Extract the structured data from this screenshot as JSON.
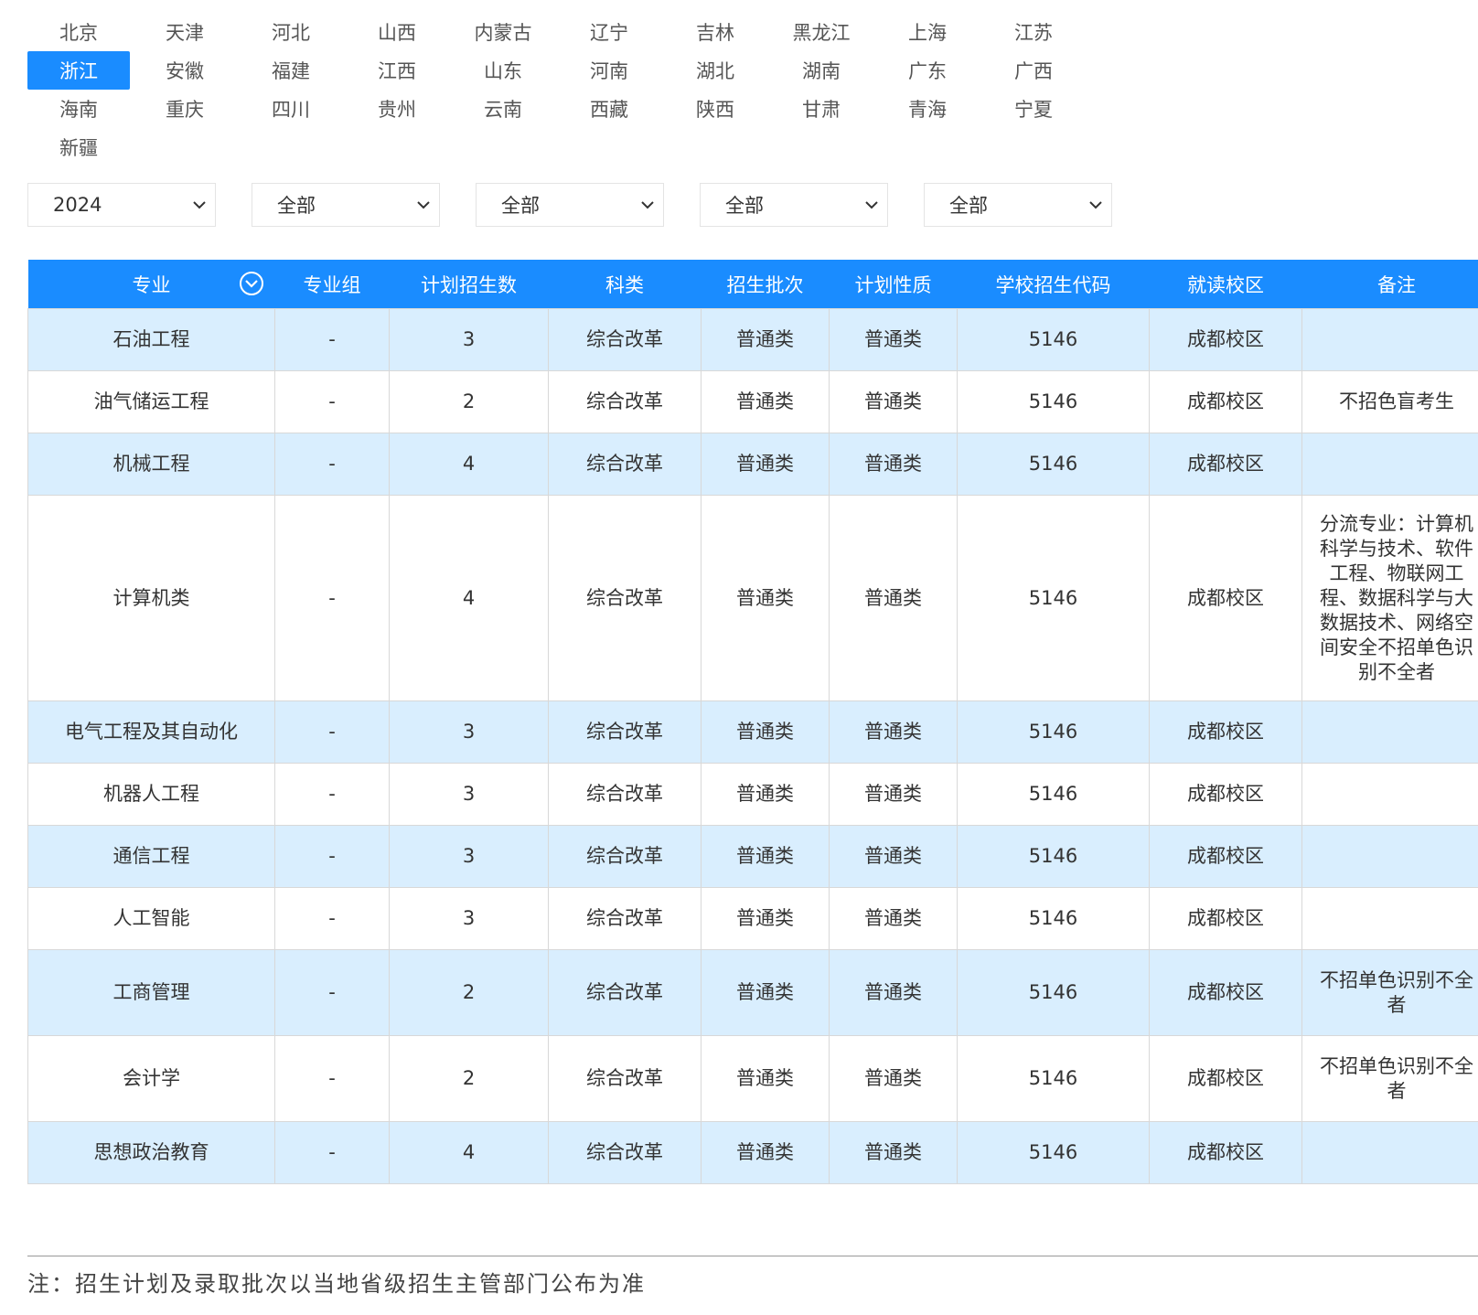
{
  "provinces": {
    "items": [
      "北京",
      "天津",
      "河北",
      "山西",
      "内蒙古",
      "辽宁",
      "吉林",
      "黑龙江",
      "上海",
      "江苏",
      "浙江",
      "安徽",
      "福建",
      "江西",
      "山东",
      "河南",
      "湖北",
      "湖南",
      "广东",
      "广西",
      "海南",
      "重庆",
      "四川",
      "贵州",
      "云南",
      "西藏",
      "陕西",
      "甘肃",
      "青海",
      "宁夏",
      "新疆"
    ],
    "selected": "浙江"
  },
  "filters": {
    "year": "2024",
    "filter2": "全部",
    "filter3": "全部",
    "filter4": "全部",
    "filter5": "全部"
  },
  "table": {
    "headers": [
      "专业",
      "专业组",
      "计划招生数",
      "科类",
      "招生批次",
      "计划性质",
      "学校招生代码",
      "就读校区",
      "备注"
    ],
    "rows": [
      [
        "石油工程",
        "-",
        "3",
        "综合改革",
        "普通类",
        "普通类",
        "5146",
        "成都校区",
        ""
      ],
      [
        "油气储运工程",
        "-",
        "2",
        "综合改革",
        "普通类",
        "普通类",
        "5146",
        "成都校区",
        "不招色盲考生"
      ],
      [
        "机械工程",
        "-",
        "4",
        "综合改革",
        "普通类",
        "普通类",
        "5146",
        "成都校区",
        ""
      ],
      [
        "计算机类",
        "-",
        "4",
        "综合改革",
        "普通类",
        "普通类",
        "5146",
        "成都校区",
        "分流专业：计算机科学与技术、软件工程、物联网工程、数据科学与大数据技术、网络空间安全不招单色识别不全者"
      ],
      [
        "电气工程及其自动化",
        "-",
        "3",
        "综合改革",
        "普通类",
        "普通类",
        "5146",
        "成都校区",
        ""
      ],
      [
        "机器人工程",
        "-",
        "3",
        "综合改革",
        "普通类",
        "普通类",
        "5146",
        "成都校区",
        ""
      ],
      [
        "通信工程",
        "-",
        "3",
        "综合改革",
        "普通类",
        "普通类",
        "5146",
        "成都校区",
        ""
      ],
      [
        "人工智能",
        "-",
        "3",
        "综合改革",
        "普通类",
        "普通类",
        "5146",
        "成都校区",
        ""
      ],
      [
        "工商管理",
        "-",
        "2",
        "综合改革",
        "普通类",
        "普通类",
        "5146",
        "成都校区",
        "不招单色识别不全者"
      ],
      [
        "会计学",
        "-",
        "2",
        "综合改革",
        "普通类",
        "普通类",
        "5146",
        "成都校区",
        "不招单色识别不全者"
      ],
      [
        "思想政治教育",
        "-",
        "4",
        "综合改革",
        "普通类",
        "普通类",
        "5146",
        "成都校区",
        ""
      ]
    ]
  },
  "footer": {
    "note": "注：招生计划及录取批次以当地省级招生主管部门公布为准"
  },
  "colors": {
    "accent": "#1a8cff",
    "row_alt": "#d9eefe"
  }
}
